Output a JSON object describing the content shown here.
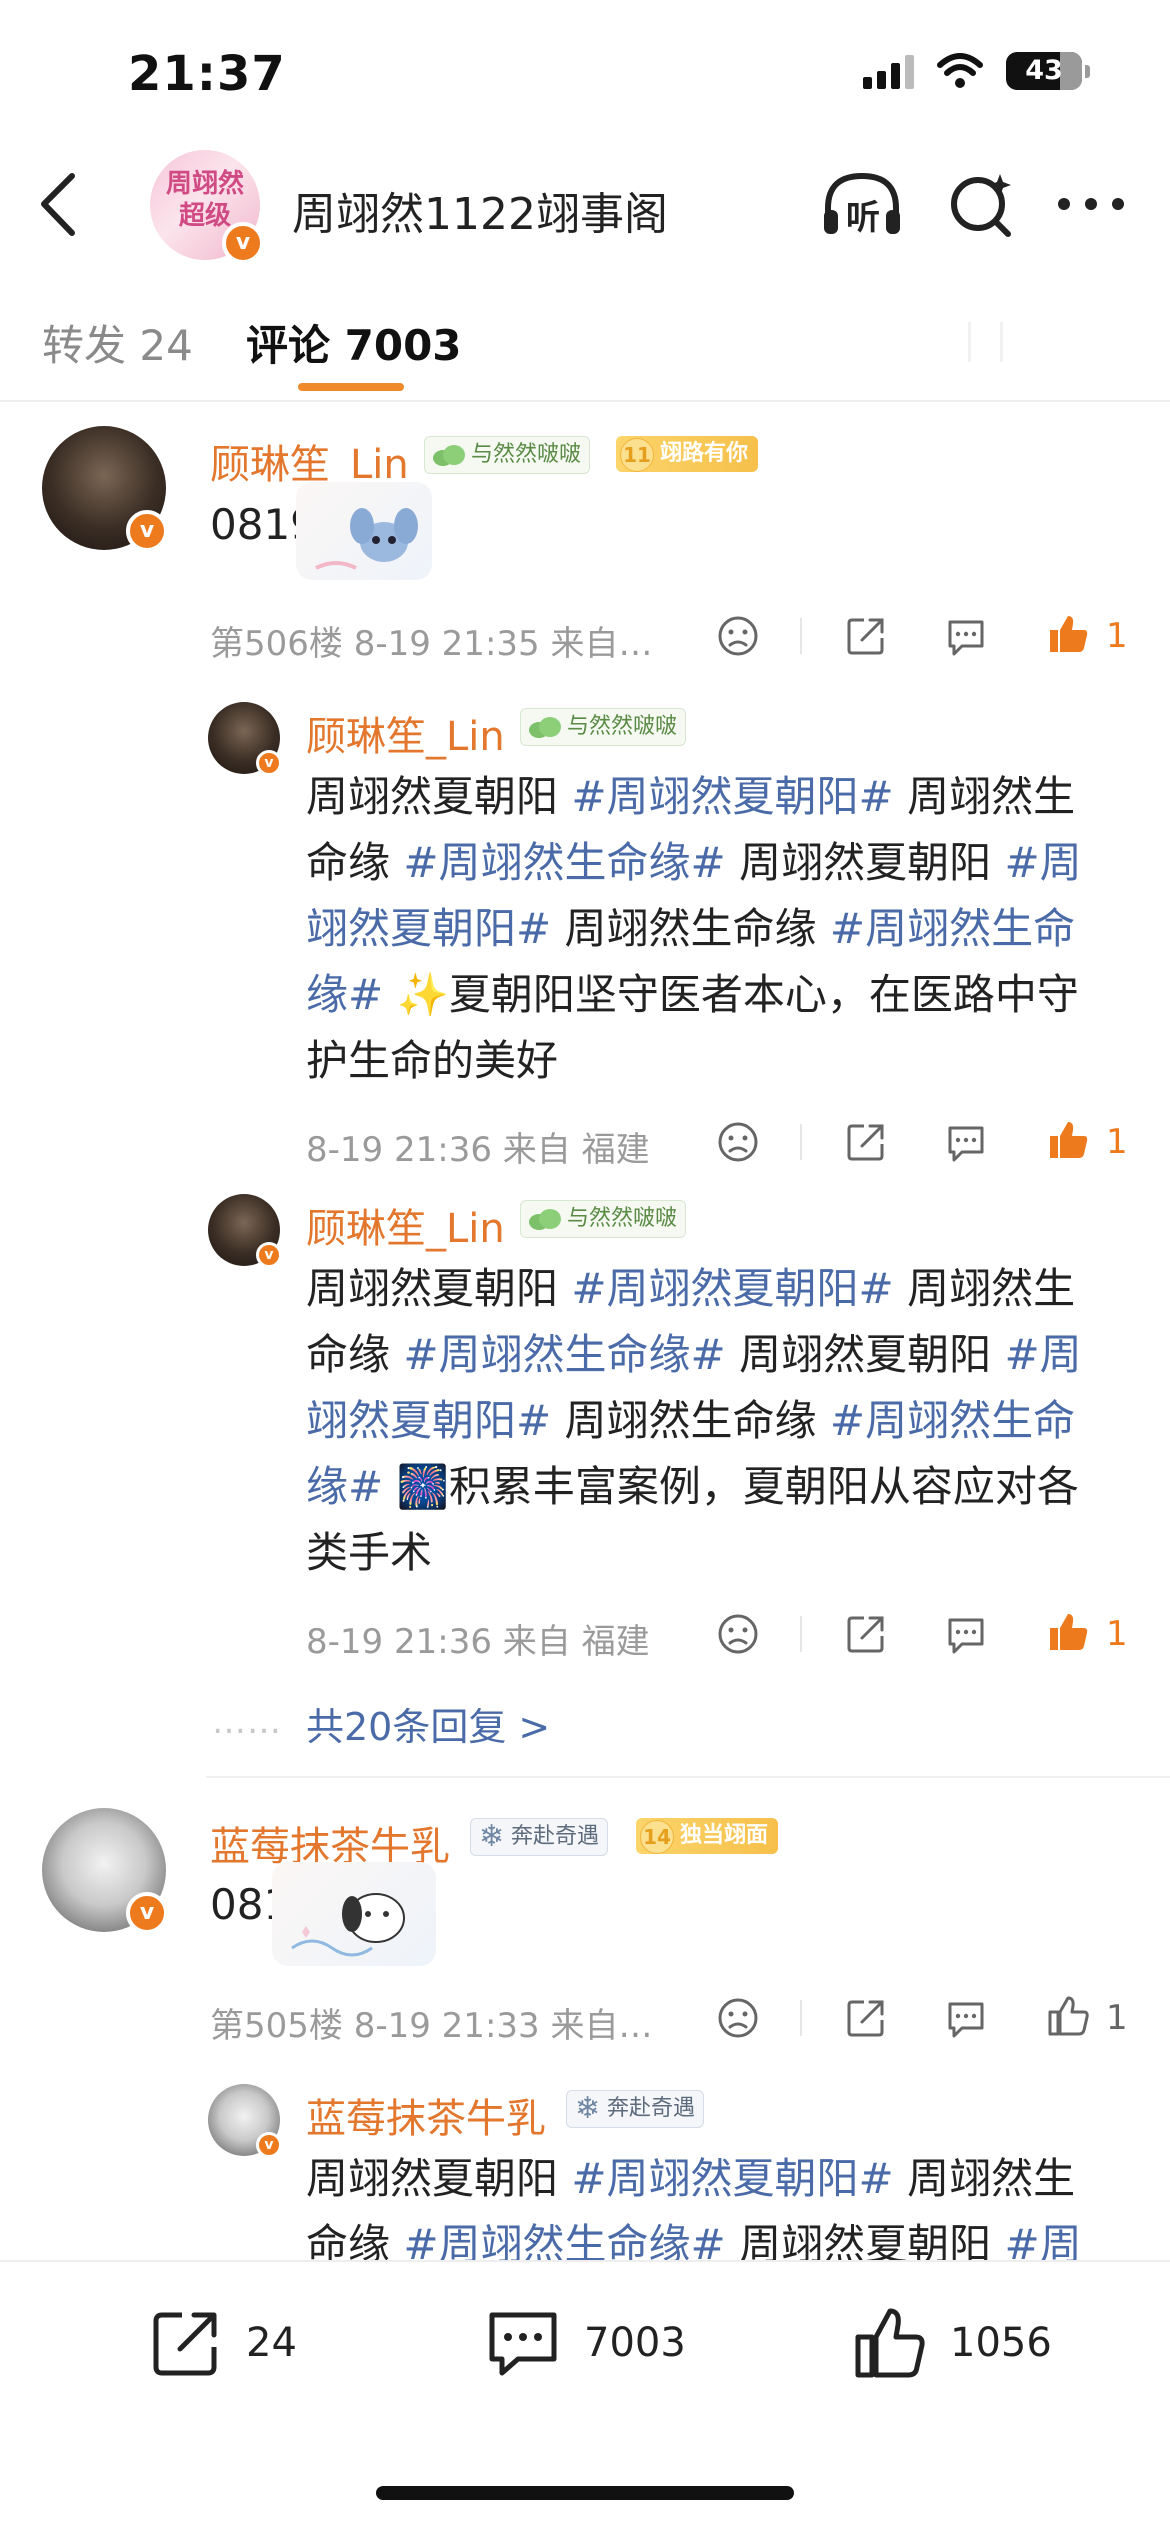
{
  "status_bar": {
    "time": "21:37",
    "battery": "43"
  },
  "header": {
    "title": "周翊然1122翊事阁",
    "avatar_text": "周翊然 超级",
    "listen_label": "听"
  },
  "tabs": [
    {
      "label": "转发 24",
      "active": false
    },
    {
      "label": "评论 7003",
      "active": true
    }
  ],
  "comments": [
    {
      "user": "顾琳笙_Lin",
      "badge_fan": "与然然啵啵",
      "badge_level": "11",
      "badge_level_text": "翊路有你",
      "text": "0819",
      "meta": "第506楼 8-19 21:35 来自…",
      "likes": "1",
      "replies": [
        {
          "user": "顾琳笙_Lin",
          "badge_fan": "与然然啵啵",
          "lines": [
            [
              "周翊然夏朝阳 ",
              "#周翊然夏朝阳#",
              " 周翊然生"
            ],
            [
              "命缘 ",
              "#周翊然生命缘#",
              " 周翊然夏朝阳 ",
              "#周"
            ],
            [
              "翊然夏朝阳#",
              " 周翊然生命缘 ",
              "#周翊然生命"
            ],
            [
              "缘#",
              " ✨夏朝阳坚守医者本心，在医路中守"
            ],
            [
              "护生命的美好"
            ]
          ],
          "meta": "8-19 21:36 来自 福建",
          "likes": "1"
        },
        {
          "user": "顾琳笙_Lin",
          "badge_fan": "与然然啵啵",
          "lines": [
            [
              "周翊然夏朝阳 ",
              "#周翊然夏朝阳#",
              " 周翊然生"
            ],
            [
              "命缘 ",
              "#周翊然生命缘#",
              " 周翊然夏朝阳 ",
              "#周"
            ],
            [
              "翊然夏朝阳#",
              " 周翊然生命缘 ",
              "#周翊然生命"
            ],
            [
              "缘#",
              " 🎆积累丰富案例，夏朝阳从容应对各"
            ],
            [
              "类手术"
            ]
          ],
          "meta": "8-19 21:36 来自 福建",
          "likes": "1"
        }
      ],
      "more_replies": "共20条回复 >"
    },
    {
      "user": "蓝莓抹茶牛乳",
      "badge_fan": "奔赴奇遇",
      "badge_level": "14",
      "badge_level_text": "独当翊面",
      "text": "0819",
      "meta": "第505楼 8-19 21:33 来自…",
      "likes": "1",
      "replies": [
        {
          "user": "蓝莓抹茶牛乳",
          "badge_fan": "奔赴奇遇",
          "lines": [
            [
              "周翊然夏朝阳 ",
              "#周翊然夏朝阳#",
              " 周翊然生"
            ],
            [
              "命缘 ",
              "#周翊然生命缘#",
              " 周翊然夏朝阳 ",
              "#周"
            ]
          ]
        }
      ]
    }
  ],
  "bottom_bar": {
    "reposts": "24",
    "comments": "7003",
    "likes": "1056"
  },
  "colors": {
    "accent": "#e2772d",
    "hashtag": "#4a6ba8",
    "tab_underline": "#f08a2a",
    "like_active": "#ee7a1e"
  },
  "icons": [
    "back-icon",
    "headphone-icon",
    "search-spark-icon",
    "more-icon",
    "sad-face-icon",
    "share-icon",
    "comment-icon",
    "like-icon"
  ]
}
